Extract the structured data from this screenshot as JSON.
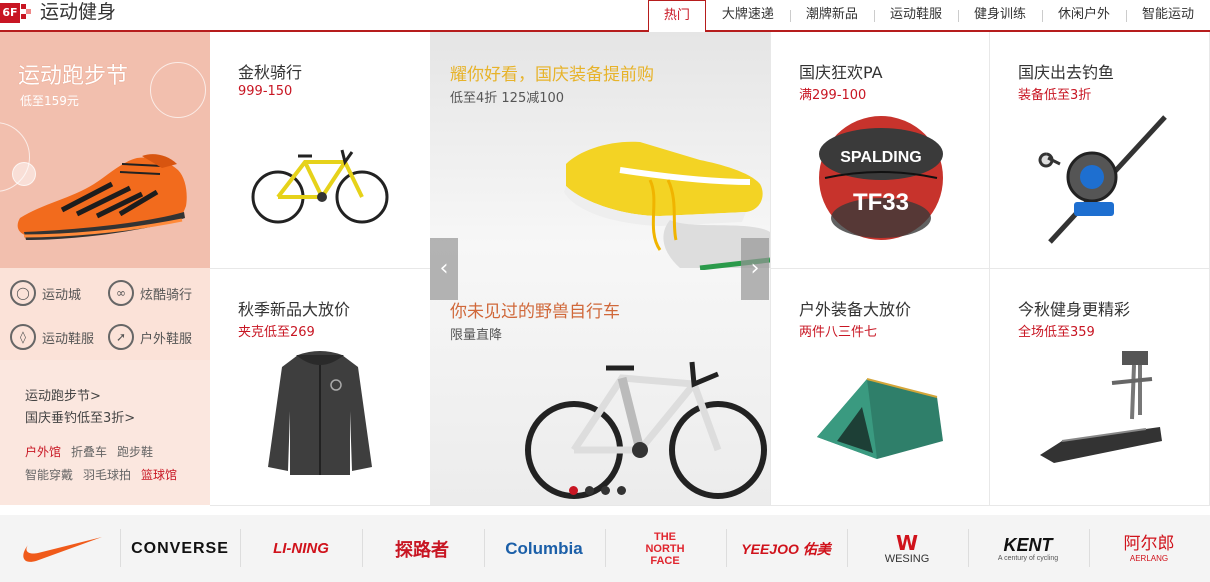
{
  "header": {
    "floor_number": "6F",
    "title": "运动健身",
    "tabs": [
      "热门",
      "大牌速递",
      "潮牌新品",
      "运动鞋服",
      "健身训练",
      "休闲户外",
      "智能运动"
    ]
  },
  "promo": {
    "title": "运动跑步节",
    "subtitle": "低至159元",
    "categories": [
      "运动城",
      "炫酷骑行",
      "运动鞋服",
      "户外鞋服"
    ],
    "links": [
      "运动跑步节>",
      "国庆垂钓低至3折>"
    ],
    "tags": [
      "户外馆",
      "折叠车",
      "跑步鞋",
      "智能穿戴",
      "羽毛球拍",
      "篮球馆"
    ]
  },
  "products": [
    {
      "title": "金秋骑行",
      "subtitle": "999-150",
      "icon": "bicycle-image"
    },
    {
      "title": "国庆狂欢PA",
      "subtitle": "满299-100",
      "icon": "basketball-image"
    },
    {
      "title": "国庆出去钓鱼",
      "subtitle": "装备低至3折",
      "icon": "fishing-reel-image"
    },
    {
      "title": "秋季新品大放价",
      "subtitle": "夹克低至269",
      "icon": "jacket-image"
    },
    {
      "title": "户外装备大放价",
      "subtitle": "两件八三件七",
      "icon": "tent-image"
    },
    {
      "title": "今秋健身更精彩",
      "subtitle": "全场低至359",
      "icon": "treadmill-image"
    }
  ],
  "carousel": {
    "top_title": "耀你好看，国庆装备提前购",
    "top_subtitle": "低至4折 125减100",
    "bottom_title": "你未见过的野兽自行车",
    "bottom_subtitle": "限量直降",
    "ball_text": "SPALDING",
    "ball_number": "TF33",
    "active_dot": 0,
    "dot_count": 4
  },
  "brands": [
    "CONVERSE",
    "LI-NING",
    "探路者",
    "Columbia",
    "THE NORTH FACE",
    "YEEJOO 佑美",
    "WESING",
    "KENT",
    "阿尔郎",
    "AERLANG"
  ],
  "brand_sub": {
    "kent": "A century of cycling"
  },
  "colors": {
    "accent": "#c81623",
    "promo_bg": "#f2bfae",
    "brands_bg": "#f4f4f4"
  }
}
